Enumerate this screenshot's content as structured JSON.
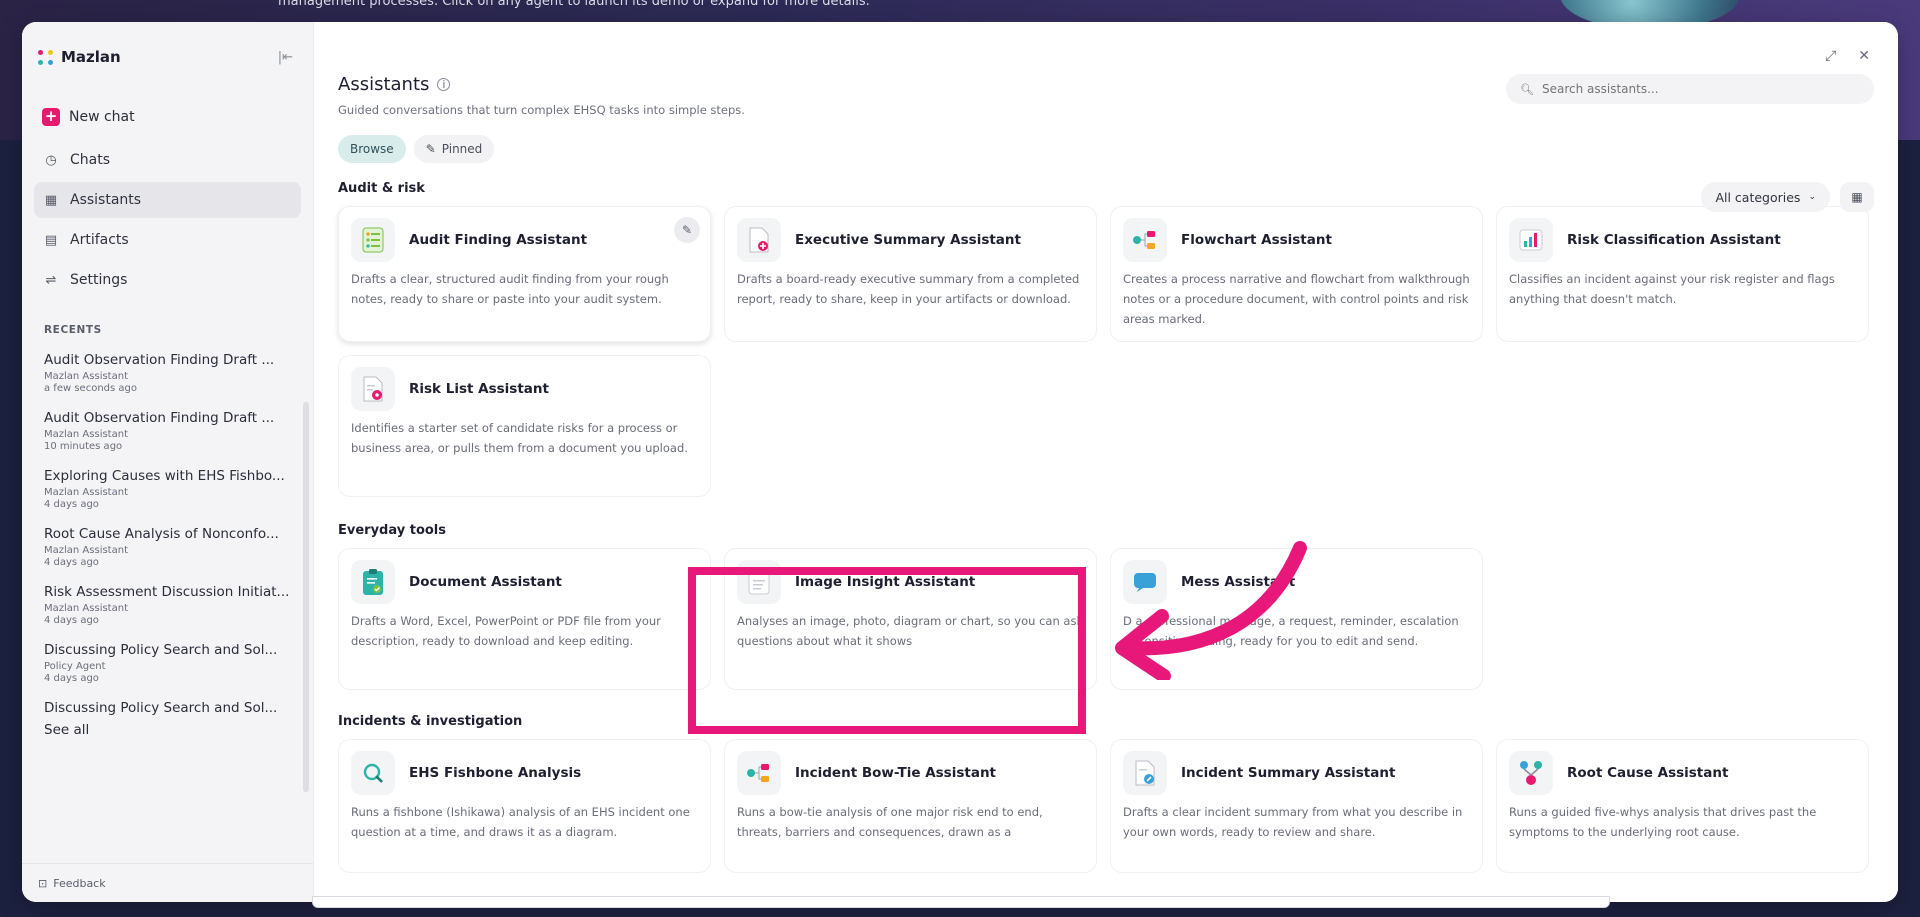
{
  "hero": {
    "text": "management processes. Click on any agent to launch its demo or expand for more details."
  },
  "colors": {
    "accent": "#e8196f",
    "highlight": "#e8177a",
    "chip_active": "#d9ecec"
  },
  "sidebar": {
    "brand": "Mazlan",
    "collapse_icon": "collapse-icon",
    "new_chat": "New chat",
    "nav": [
      {
        "label": "Chats",
        "icon": "chat-icon"
      },
      {
        "label": "Assistants",
        "icon": "grid-icon",
        "active": true
      },
      {
        "label": "Artifacts",
        "icon": "document-icon"
      },
      {
        "label": "Settings",
        "icon": "sliders-icon"
      }
    ],
    "recents_label": "RECENTS",
    "recents": [
      {
        "title": "Audit Observation Finding Draft ...",
        "agent": "Mazlan Assistant",
        "time": "a few seconds ago"
      },
      {
        "title": "Audit Observation Finding Draft ...",
        "agent": "Mazlan Assistant",
        "time": "10 minutes ago"
      },
      {
        "title": "Exploring Causes with EHS Fishbo...",
        "agent": "Mazlan Assistant",
        "time": "4 days ago"
      },
      {
        "title": "Root Cause Analysis of Nonconfo...",
        "agent": "Mazlan Assistant",
        "time": "4 days ago"
      },
      {
        "title": "Risk Assessment Discussion Initiat...",
        "agent": "Mazlan Assistant",
        "time": "4 days ago"
      },
      {
        "title": "Discussing Policy Search and Sol...",
        "agent": "Policy Agent",
        "time": "4 days ago"
      },
      {
        "title": "Discussing Policy Search and Sol...",
        "agent": "",
        "time": ""
      }
    ],
    "see_all": "See all",
    "feedback": "Feedback"
  },
  "main": {
    "title": "Assistants",
    "subtitle": "Guided conversations that turn complex EHSQ tasks into simple steps.",
    "search_placeholder": "Search assistants...",
    "tabs": [
      {
        "label": "Browse",
        "active": true
      },
      {
        "label": "Pinned"
      }
    ],
    "category_select": "All categories",
    "sections": [
      {
        "title": "Audit & risk",
        "cards": [
          {
            "title": "Audit Finding Assistant",
            "desc": "Drafts a clear, structured audit finding from your rough notes, ready to share or paste into your audit system.",
            "icon": "checklist-icon",
            "pinned": true
          },
          {
            "title": "Executive Summary Assistant",
            "desc": "Drafts a board-ready executive summary from a completed report, ready to share, keep in your artifacts or download.",
            "icon": "doc-add-icon"
          },
          {
            "title": "Flowchart Assistant",
            "desc": "Creates a process narrative and flowchart from walkthrough notes or a procedure document, with control points and risk areas marked.",
            "icon": "flowchart-icon"
          },
          {
            "title": "Risk Classification Assistant",
            "desc": "Classifies an incident against your risk register and flags anything that doesn't match.",
            "icon": "bar-chart-icon"
          },
          {
            "title": "Risk List Assistant",
            "desc": "Identifies a starter set of candidate risks for a process or business area, or pulls them from a document you upload.",
            "icon": "doc-alert-icon"
          }
        ]
      },
      {
        "title": "Everyday tools",
        "cards": [
          {
            "title": "Document Assistant",
            "desc": "Drafts a Word, Excel, PowerPoint or PDF file from your description, ready to download and keep editing.",
            "icon": "clipboard-check-icon"
          },
          {
            "title": "Image Insight Assistant",
            "desc": "Analyses an image, photo, diagram or chart, so you can ask questions about what it shows",
            "icon": "image-doc-icon"
          },
          {
            "title": "Message Assistant",
            "title_visible": "Mess  Assistant",
            "desc": "Drafts a professional message, a request, reminder, escalation or sensitive finding, ready for you to edit and send.",
            "desc_visible": "D   a professional message, a request, reminder, escalation or sensitive finding, ready for you to edit and send.",
            "icon": "message-icon"
          }
        ]
      },
      {
        "title": "Incidents & investigation",
        "cards": [
          {
            "title": "EHS Fishbone Analysis",
            "desc": "Runs a fishbone (Ishikawa) analysis of an EHS incident one question at a time, and draws it as a diagram.",
            "icon": "search-q-icon"
          },
          {
            "title": "Incident Bow-Tie Assistant",
            "desc": "Runs a bow-tie analysis of one major risk end to end, threats, barriers and consequences, drawn as a",
            "icon": "bowtie-icon"
          },
          {
            "title": "Incident Summary Assistant",
            "desc": "Drafts a clear incident summary from what you describe in your own words, ready to review and share.",
            "icon": "doc-edit-icon"
          },
          {
            "title": "Root Cause Assistant",
            "desc": "Runs a guided five-whys analysis that drives past the symptoms to the underlying root cause.",
            "icon": "tree-icon"
          }
        ]
      }
    ]
  }
}
